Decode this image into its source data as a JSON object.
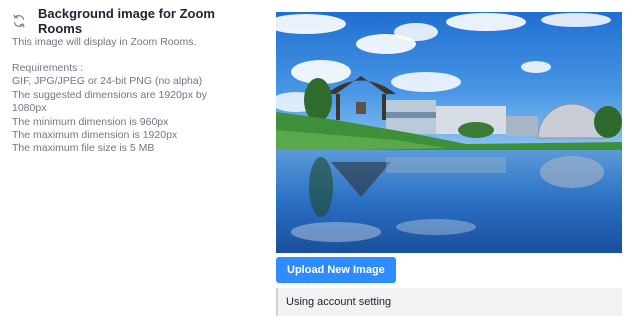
{
  "section": {
    "title": "Background image for Zoom Rooms",
    "description": "This image will display in Zoom Rooms.",
    "requirements": [
      "Requirements :",
      "GIF, JPG/JPEG or 24-bit PNG (no alpha)",
      "The suggested dimensions are 1920px by",
      "1080px",
      "The minimum dimension is 960px",
      "The maximum dimension is 1920px",
      "The maximum file size is 5 MB"
    ],
    "icon": "sync-icon"
  },
  "preview": {
    "icon": "landscape-image"
  },
  "actions": {
    "upload_label": "Upload New Image",
    "upload_color": "#2d8cff"
  },
  "setting": {
    "status": "Using account setting"
  }
}
